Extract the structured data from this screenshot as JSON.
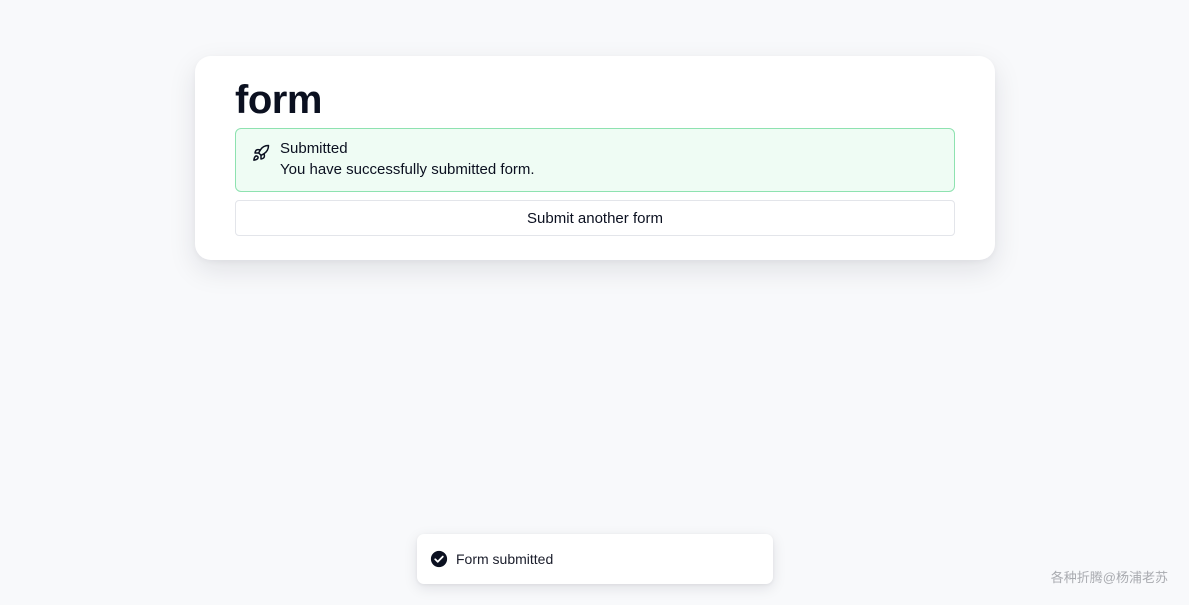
{
  "form": {
    "title": "form",
    "alert": {
      "icon": "rocket-icon",
      "title": "Submitted",
      "description": "You have successfully submitted form."
    },
    "submit_another_label": "Submit another form"
  },
  "toast": {
    "icon": "check-circle-icon",
    "message": "Form submitted"
  },
  "watermark": {
    "text": "各种折腾@杨浦老苏"
  },
  "colors": {
    "background": "#f8f9fb",
    "alert_background": "#effcf4",
    "alert_border": "#8ee2b0",
    "text": "#0b1020"
  }
}
